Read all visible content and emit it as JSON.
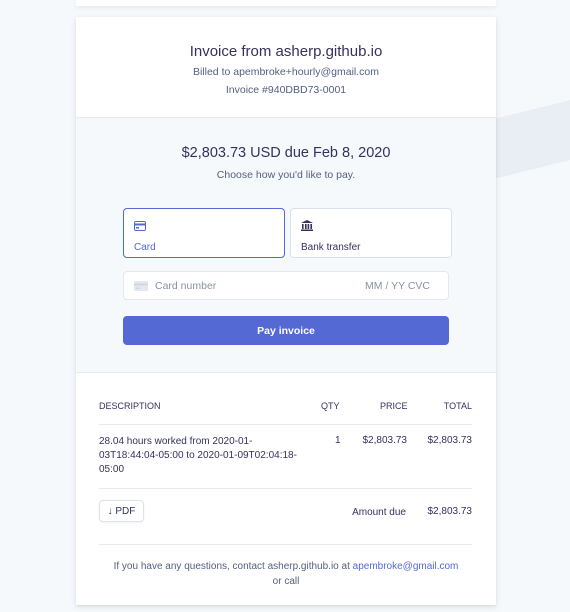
{
  "header": {
    "title": "Invoice from asherp.github.io",
    "billed_to": "Billed to apembroke+hourly@gmail.com",
    "invoice_number": "Invoice #940DBD73-0001"
  },
  "payment": {
    "amount_due": "$2,803.73 USD due Feb 8, 2020",
    "choose_text": "Choose how you'd like to pay.",
    "methods": [
      {
        "label": "Card",
        "icon": "credit-card-icon",
        "selected": true
      },
      {
        "label": "Bank transfer",
        "icon": "bank-icon",
        "selected": false
      }
    ],
    "card_number_placeholder": "Card number",
    "expiry_cvc_placeholder": "MM / YY  CVC",
    "pay_button": "Pay invoice"
  },
  "table": {
    "headers": {
      "description": "DESCRIPTION",
      "qty": "QTY",
      "price": "PRICE",
      "total": "TOTAL"
    },
    "rows": [
      {
        "description": "28.04 hours worked from 2020-01-03T18:44:04-05:00 to 2020-01-09T02:04:18-05:00",
        "qty": "1",
        "price": "$2,803.73",
        "total": "$2,803.73"
      }
    ],
    "pdf_button": "PDF",
    "amount_due_label": "Amount due",
    "amount_due_value": "$2,803.73"
  },
  "contact": {
    "prefix": "If you have any questions, contact asherp.github.io at ",
    "email": "apembroke@gmail.com",
    "suffix": "or call"
  },
  "colors": {
    "accent": "#5469d4",
    "background": "#f6f9fc",
    "text": "#32325d"
  }
}
